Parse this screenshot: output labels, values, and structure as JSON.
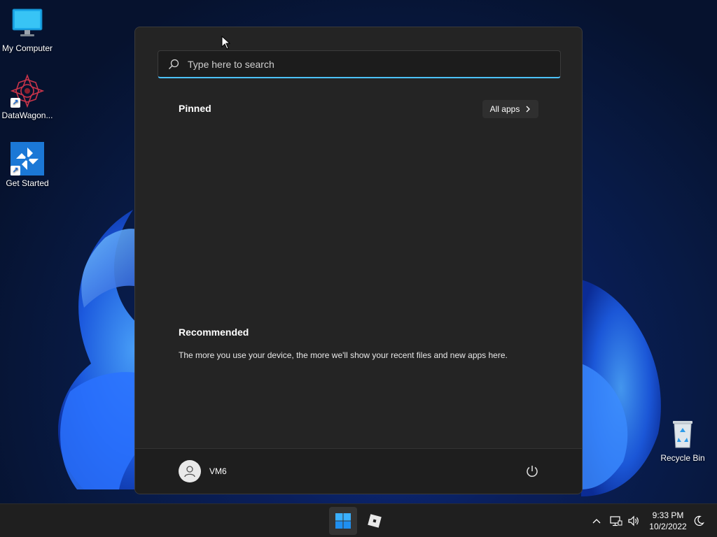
{
  "desktop": {
    "icons": [
      {
        "label": "My Computer"
      },
      {
        "label": "DataWagon..."
      },
      {
        "label": "Get Started"
      },
      {
        "label": "Recycle Bin"
      }
    ]
  },
  "start_menu": {
    "search": {
      "placeholder": "Type here to search",
      "value": ""
    },
    "pinned": {
      "title": "Pinned",
      "all_apps_label": "All apps"
    },
    "recommended": {
      "title": "Recommended",
      "message": "The more you use your device, the more we'll show your recent files and new apps here."
    },
    "user": {
      "name": "VM6"
    },
    "power_icon": "power-icon"
  },
  "taskbar": {
    "start_icon": "windows-logo-icon",
    "apps": [
      {
        "icon": "roblox-icon"
      }
    ],
    "tray": {
      "chevron_icon": "chevron-up-icon",
      "network_icon": "network-icon",
      "volume_icon": "volume-icon",
      "time": "9:33 PM",
      "date": "10/2/2022",
      "focus_icon": "moon-icon"
    }
  },
  "colors": {
    "accent": "#4cc2ff",
    "menu_bg": "#242424",
    "taskbar_bg": "#1f1f1f"
  }
}
